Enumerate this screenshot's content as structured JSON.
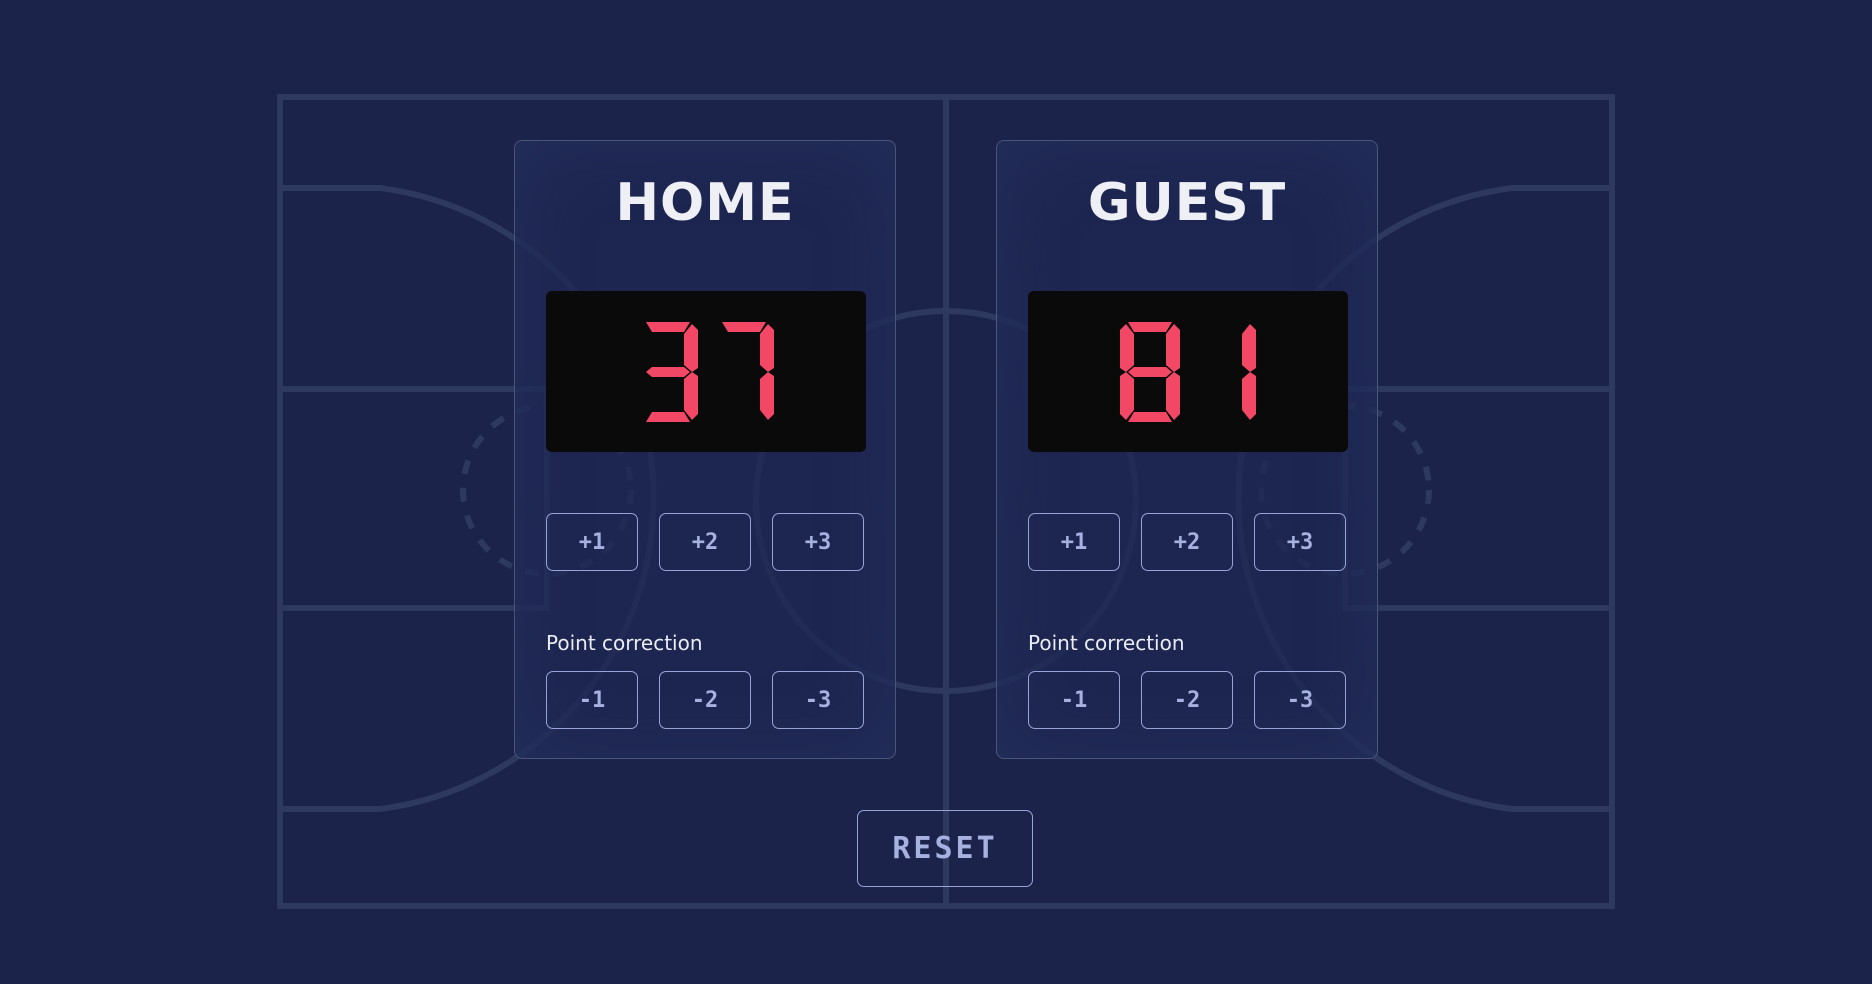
{
  "colors": {
    "background": "#1b234b",
    "court_lines": "#2e3960",
    "panel_border": "#4a557a",
    "digit_on": "#f24866",
    "button_border": "#98a4d8",
    "button_text": "#a6b1e0"
  },
  "home": {
    "name": "HOME",
    "score": "37",
    "add_buttons": [
      "+1",
      "+2",
      "+3"
    ],
    "correction_label": "Point correction",
    "subtract_buttons": [
      "-1",
      "-2",
      "-3"
    ]
  },
  "guest": {
    "name": "GUEST",
    "score": "81",
    "add_buttons": [
      "+1",
      "+2",
      "+3"
    ],
    "correction_label": "Point correction",
    "subtract_buttons": [
      "-1",
      "-2",
      "-3"
    ]
  },
  "reset_label": "RESET"
}
